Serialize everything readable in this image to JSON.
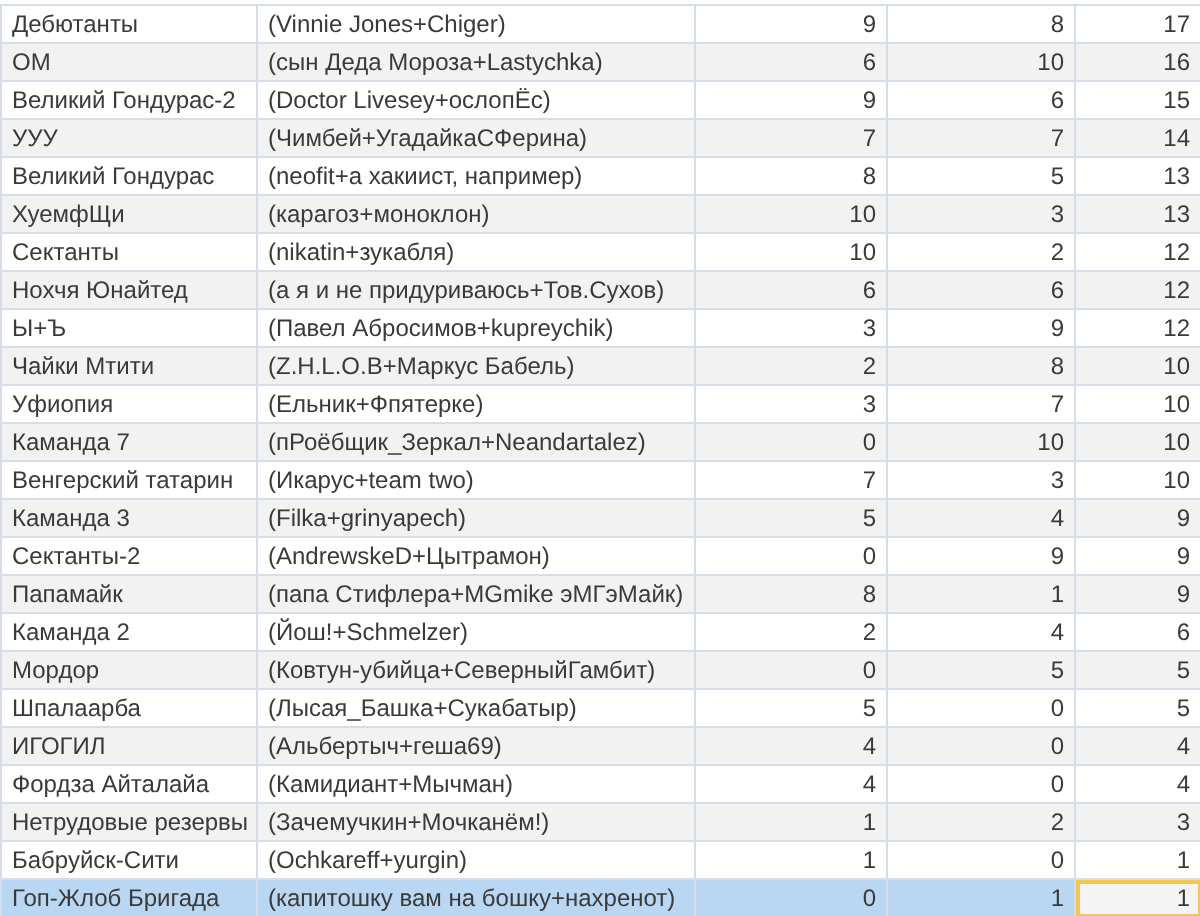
{
  "rows": [
    {
      "team": "Дебютанты",
      "players": "(Vinnie Jones+Chiger)",
      "column_3": "9",
      "column_4": "8",
      "column_5": "17",
      "selected": false,
      "active": false
    },
    {
      "team": "ОМ",
      "players": "(сын Деда Мороза+Lastychka)",
      "column_3": "6",
      "column_4": "10",
      "column_5": "16",
      "selected": false,
      "active": false
    },
    {
      "team": "Великий Гондурас-2",
      "players": "(Doctor Livesey+ослопЁс)",
      "column_3": "9",
      "column_4": "6",
      "column_5": "15",
      "selected": false,
      "active": false
    },
    {
      "team": "УУУ",
      "players": "(Чимбей+УгадайкаСФерина)",
      "column_3": "7",
      "column_4": "7",
      "column_5": "14",
      "selected": false,
      "active": false
    },
    {
      "team": "Великий Гондурас",
      "players": "(neofit+а хакиист, например)",
      "column_3": "8",
      "column_4": "5",
      "column_5": "13",
      "selected": false,
      "active": false
    },
    {
      "team": "ХуемфЩи",
      "players": "(карагоз+моноклон)",
      "column_3": "10",
      "column_4": "3",
      "column_5": "13",
      "selected": false,
      "active": false
    },
    {
      "team": "Сектанты",
      "players": "(nikatin+зукабля)",
      "column_3": "10",
      "column_4": "2",
      "column_5": "12",
      "selected": false,
      "active": false
    },
    {
      "team": "Нохчя Юнайтед",
      "players": "(а я и не придуриваюсь+Тов.Сухов)",
      "column_3": "6",
      "column_4": "6",
      "column_5": "12",
      "selected": false,
      "active": false
    },
    {
      "team": "Ы+Ъ",
      "players": "(Павел Абросимов+kupreychik)",
      "column_3": "3",
      "column_4": "9",
      "column_5": "12",
      "selected": false,
      "active": false
    },
    {
      "team": "Чайки Мтити",
      "players": "(Z.H.L.O.B+Маркус Бабель)",
      "column_3": "2",
      "column_4": "8",
      "column_5": "10",
      "selected": false,
      "active": false
    },
    {
      "team": "Уфиопия",
      "players": "(Ельник+Фпятерке)",
      "column_3": "3",
      "column_4": "7",
      "column_5": "10",
      "selected": false,
      "active": false
    },
    {
      "team": "Каманда 7",
      "players": "(пРоёбщик_Зеркал+Neandartalez)",
      "column_3": "0",
      "column_4": "10",
      "column_5": "10",
      "selected": false,
      "active": false
    },
    {
      "team": "Венгерский татарин",
      "players": "(Икарус+team two)",
      "column_3": "7",
      "column_4": "3",
      "column_5": "10",
      "selected": false,
      "active": false
    },
    {
      "team": "Каманда 3",
      "players": "(Filka+grinyapech)",
      "column_3": "5",
      "column_4": "4",
      "column_5": "9",
      "selected": false,
      "active": false
    },
    {
      "team": "Сектанты-2",
      "players": "(AndrewskeD+Цытрамон)",
      "column_3": "0",
      "column_4": "9",
      "column_5": "9",
      "selected": false,
      "active": false
    },
    {
      "team": "Папамайк",
      "players": "(папа Стифлера+MGmike эМГэМайк)",
      "column_3": "8",
      "column_4": "1",
      "column_5": "9",
      "selected": false,
      "active": false
    },
    {
      "team": "Каманда 2",
      "players": "(Йош!+Schmelzer)",
      "column_3": "2",
      "column_4": "4",
      "column_5": "6",
      "selected": false,
      "active": false
    },
    {
      "team": "Мордор",
      "players": "(Ковтун-убийца+СеверныйГамбит)",
      "column_3": "0",
      "column_4": "5",
      "column_5": "5",
      "selected": false,
      "active": false
    },
    {
      "team": "Шпалаарба",
      "players": "(Лысая_Башка+Сукабатыр)",
      "column_3": "5",
      "column_4": "0",
      "column_5": "5",
      "selected": false,
      "active": false
    },
    {
      "team": "ИГОГИЛ",
      "players": "(Альбертыч+геша69)",
      "column_3": "4",
      "column_4": "0",
      "column_5": "4",
      "selected": false,
      "active": false
    },
    {
      "team": "Фордза Айталайа",
      "players": "(Камидиант+Мычман)",
      "column_3": "4",
      "column_4": "0",
      "column_5": "4",
      "selected": false,
      "active": false
    },
    {
      "team": "Нетрудовые резервы",
      "players": "(Зачемучкин+Мочканём!)",
      "column_3": "1",
      "column_4": "2",
      "column_5": "3",
      "selected": false,
      "active": false
    },
    {
      "team": "Бабруйск-Сити",
      "players": "(Ochkareff+yurgin)",
      "column_3": "1",
      "column_4": "0",
      "column_5": "1",
      "selected": false,
      "active": false
    },
    {
      "team": "Гоп-Жлоб Бригада",
      "players": "(капитошку вам на бошку+нахренот)",
      "column_3": "0",
      "column_4": "1",
      "column_5": "1",
      "selected": true,
      "active": true
    }
  ]
}
